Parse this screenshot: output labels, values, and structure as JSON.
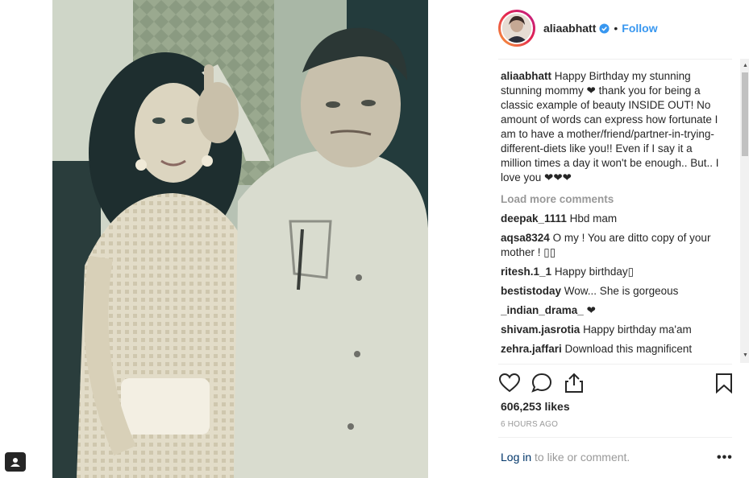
{
  "header": {
    "username": "aliaabhatt",
    "verified_icon": "verified-badge-icon",
    "separator": "•",
    "follow_label": "Follow"
  },
  "caption": {
    "username": "aliaabhatt",
    "text": "Happy Birthday my stunning stunning mommy ❤ thank you for being a classic example of beauty INSIDE OUT! No amount of words can express how fortunate I am to have a mother/friend/partner-in-trying-different-diets like you!! Even if I say it a million times a day it won't be enough.. But.. I love you ❤❤❤"
  },
  "load_more_label": "Load more comments",
  "comments": [
    {
      "username": "deepak_1111",
      "text": "Hbd mam"
    },
    {
      "username": "aqsa8324",
      "text": "O my ! You are ditto copy of your mother ! ▯▯"
    },
    {
      "username": "ritesh.1_1",
      "text": "Happy birthday▯"
    },
    {
      "username": "bestistoday",
      "text": "Wow... She is gorgeous"
    },
    {
      "username": "_indian_drama_",
      "text": "❤"
    },
    {
      "username": "shivam.jasrotia",
      "text": "Happy birthday ma'am"
    },
    {
      "username": "zehra.jaffari",
      "text": "Download this magnificent"
    }
  ],
  "actions": {
    "like_icon": "heart-icon",
    "comment_icon": "comment-icon",
    "share_icon": "share-icon",
    "save_icon": "bookmark-icon"
  },
  "likes_label": "606,253 likes",
  "timestamp": "6 HOURS AGO",
  "footer": {
    "login_label": "Log in",
    "login_suffix": " to like or comment.",
    "more_label": "•••"
  },
  "colors": {
    "accent_blue": "#3897f0",
    "text": "#262626",
    "muted": "#999999",
    "login_link": "#003569"
  }
}
